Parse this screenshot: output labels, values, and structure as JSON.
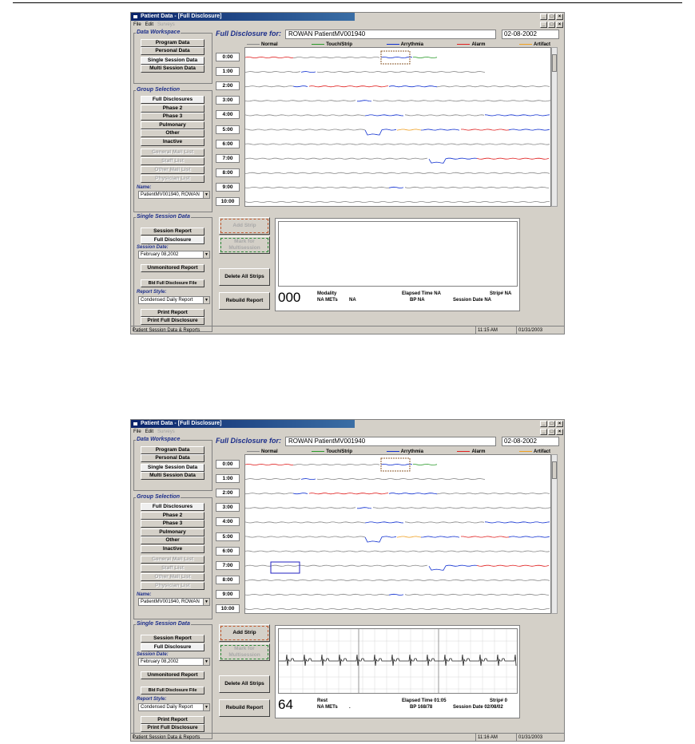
{
  "windows": [
    {
      "title": "Patient Data - [Full Disclosure]",
      "window_buttons": [
        "_",
        "□",
        "×"
      ],
      "menu": {
        "items": [
          "File",
          "Edit",
          "Surveys"
        ]
      },
      "workspace": {
        "title": "Data Workspace",
        "buttons": [
          "Program Data",
          "Personal Data",
          "Single Session Data",
          "Multi Session Data"
        ]
      },
      "group_selection": {
        "title": "Group Selection",
        "buttons": [
          "Full Disclosures",
          "Phase 2",
          "Phase 3",
          "Pulmonary",
          "Other",
          "Inactive"
        ],
        "disabled_buttons": [
          "General Mail List",
          "Staff List",
          "Other Mail List",
          "Physician List"
        ],
        "name_label": "Name:",
        "name_value": "PatientMV001940, ROWAN"
      },
      "single_session": {
        "title": "Single Session Data",
        "buttons": [
          "Session Report",
          "Full Disclosure"
        ],
        "session_date_label": "Session Date:",
        "session_date": "February 08,2002",
        "unmonitored_button": "Unmonitored Report",
        "bld_button": "Bld Full Disclosure File",
        "report_style_label": "Report Style:",
        "report_style": "Condensed Daily Report",
        "print_report": "Print Report",
        "print_full": "Print Full Disclosure"
      },
      "full_disclosure": {
        "label": "Full Disclosure for:",
        "patient": "ROWAN PatientMV001940",
        "date": "02-08-2002",
        "legend": [
          "Normal",
          "Touch/Strip",
          "Arrythmia",
          "Alarm",
          "Artifact"
        ],
        "legend_colors": [
          "#888888",
          "#2a9a2a",
          "#1030d0",
          "#e02020",
          "#f0a020"
        ],
        "hours": [
          "0:00",
          "1:00",
          "2:00",
          "3:00",
          "4:00",
          "5:00",
          "6:00",
          "7:00",
          "8:00",
          "9:00",
          "10:00"
        ]
      },
      "actions": {
        "add_strip": "Add Strip",
        "mark": "Mark for Multisession",
        "delete_all": "Delete All Strips",
        "rebuild": "Rebuild Report",
        "add_enabled": false
      },
      "strip": {
        "hr": "000",
        "modality_label": "Modality",
        "modality": "NA METs",
        "mets": "NA",
        "elapsed": "Elapsed Time NA",
        "bp": "BP NA",
        "strip_no": "Strip# NA",
        "session_date": "Session Date NA",
        "has_ecg": false
      },
      "status": {
        "text": "Patient Session Data & Reports",
        "time": "11:15 AM",
        "date": "01/31/2003"
      }
    },
    {
      "title": "Patient Data - [Full Disclosure]",
      "window_buttons": [
        "_",
        "□",
        "×"
      ],
      "menu": {
        "items": [
          "File",
          "Edit",
          "Surveys"
        ]
      },
      "workspace": {
        "title": "Data Workspace",
        "buttons": [
          "Program Data",
          "Personal Data",
          "Single Session Data",
          "Multi Session Data"
        ]
      },
      "group_selection": {
        "title": "Group Selection",
        "buttons": [
          "Full Disclosures",
          "Phase 2",
          "Phase 3",
          "Pulmonary",
          "Other",
          "Inactive"
        ],
        "disabled_buttons": [
          "General Mail List",
          "Staff List",
          "Other Mail List",
          "Physician List"
        ],
        "name_label": "Name:",
        "name_value": "PatientMV001940, ROWAN"
      },
      "single_session": {
        "title": "Single Session Data",
        "buttons": [
          "Session Report",
          "Full Disclosure"
        ],
        "session_date_label": "Session Date:",
        "session_date": "February 08,2002",
        "unmonitored_button": "Unmonitored Report",
        "bld_button": "Bld Full Disclosure File",
        "report_style_label": "Report Style:",
        "report_style": "Condensed Daily Report",
        "print_report": "Print Report",
        "print_full": "Print Full Disclosure"
      },
      "full_disclosure": {
        "label": "Full Disclosure for:",
        "patient": "ROWAN PatientMV001940",
        "date": "02-08-2002",
        "legend": [
          "Normal",
          "Touch/Strip",
          "Arrythmia",
          "Alarm",
          "Artifact"
        ],
        "legend_colors": [
          "#888888",
          "#2a9a2a",
          "#1030d0",
          "#e02020",
          "#f0a020"
        ],
        "hours": [
          "0:00",
          "1:00",
          "2:00",
          "3:00",
          "4:00",
          "5:00",
          "6:00",
          "7:00",
          "8:00",
          "9:00",
          "10:00"
        ]
      },
      "actions": {
        "add_strip": "Add Strip",
        "mark": "Mark for Multisession",
        "delete_all": "Delete All Strips",
        "rebuild": "Rebuild Report",
        "add_enabled": true
      },
      "strip": {
        "hr": "64",
        "modality_label": "Rest",
        "modality": "NA METs",
        "mets": ".",
        "elapsed": "Elapsed Time 01:05",
        "bp": "BP 168/78",
        "strip_no": "Strip# 0",
        "session_date": "Session Date 02/08/02",
        "has_ecg": true
      },
      "status": {
        "text": "Patient Session Data & Reports",
        "time": "11:16 AM",
        "date": "01/31/2003"
      }
    }
  ]
}
